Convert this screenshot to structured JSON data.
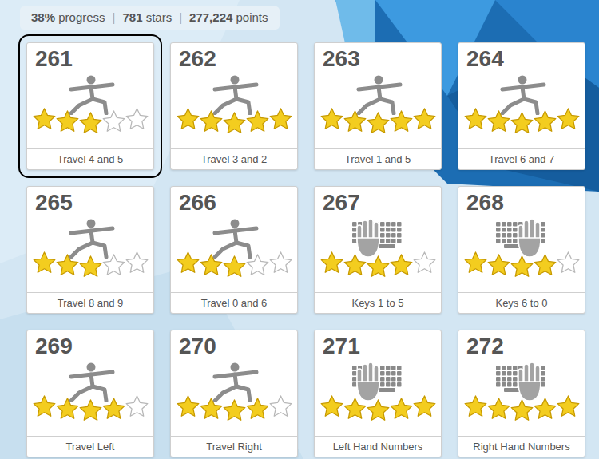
{
  "stats": [
    {
      "value": "38%",
      "label": "progress"
    },
    {
      "value": "781",
      "label": "stars"
    },
    {
      "value": "277,224",
      "label": "points"
    }
  ],
  "separator": "|",
  "lessons": [
    {
      "number": "261",
      "label": "Travel 4 and 5",
      "kind": "pose",
      "stars": 3,
      "selected": true
    },
    {
      "number": "262",
      "label": "Travel 3 and 2",
      "kind": "pose",
      "stars": 5,
      "selected": false
    },
    {
      "number": "263",
      "label": "Travel 1 and 5",
      "kind": "pose",
      "stars": 5,
      "selected": false
    },
    {
      "number": "264",
      "label": "Travel 6 and 7",
      "kind": "pose",
      "stars": 5,
      "selected": false
    },
    {
      "number": "265",
      "label": "Travel 8 and 9",
      "kind": "pose",
      "stars": 3,
      "selected": false
    },
    {
      "number": "266",
      "label": "Travel 0 and 6",
      "kind": "pose",
      "stars": 3,
      "selected": false
    },
    {
      "number": "267",
      "label": "Keys 1 to 5",
      "kind": "lefthand",
      "stars": 4,
      "selected": false
    },
    {
      "number": "268",
      "label": "Keys 6 to 0",
      "kind": "righthand",
      "stars": 4,
      "selected": false
    },
    {
      "number": "269",
      "label": "Travel Left",
      "kind": "pose",
      "stars": 4,
      "selected": false
    },
    {
      "number": "270",
      "label": "Travel Right",
      "kind": "pose",
      "stars": 4,
      "selected": false
    },
    {
      "number": "271",
      "label": "Left Hand Numbers",
      "kind": "lefthand",
      "stars": 5,
      "selected": false
    },
    {
      "number": "272",
      "label": "Right Hand Numbers",
      "kind": "righthand",
      "stars": 5,
      "selected": false
    }
  ]
}
